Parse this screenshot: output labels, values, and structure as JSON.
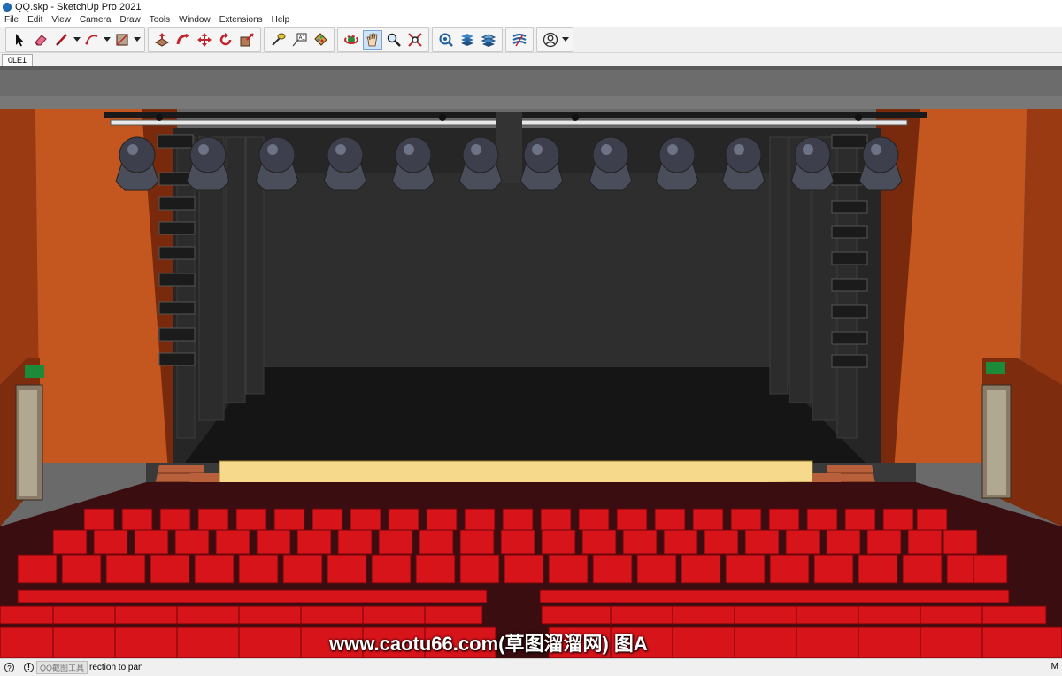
{
  "window": {
    "title": "QQ.skp - SketchUp Pro 2021"
  },
  "menu": [
    "File",
    "Edit",
    "View",
    "Camera",
    "Draw",
    "Tools",
    "Window",
    "Extensions",
    "Help"
  ],
  "scene_tab": "0LE1",
  "watermark": "www.caotu66.com(草图溜溜网) 图A",
  "status": {
    "tag": "QQ截图工具",
    "text": "rection to pan",
    "right": "M"
  },
  "icons": [
    "select-icon",
    "eraser-icon",
    "line-icon",
    "arc-icon",
    "shape-icon",
    "push-pull-icon",
    "follow-me-icon",
    "move-icon",
    "rotate-icon",
    "scale-icon",
    "tape-measure-icon",
    "text-icon",
    "paint-bucket-icon",
    "orbit-icon",
    "pan-icon",
    "zoom-icon",
    "zoom-extents-icon",
    "3d-warehouse-icon",
    "extension-warehouse-icon",
    "layout-icon",
    "sandbox-icon",
    "account-icon"
  ],
  "colors": {
    "wall": "#c1521f",
    "seat": "#d8141b",
    "stage_floor": "#1a1a1a",
    "stage_edge": "#f6d98a",
    "carpet": "#3a0d10"
  }
}
